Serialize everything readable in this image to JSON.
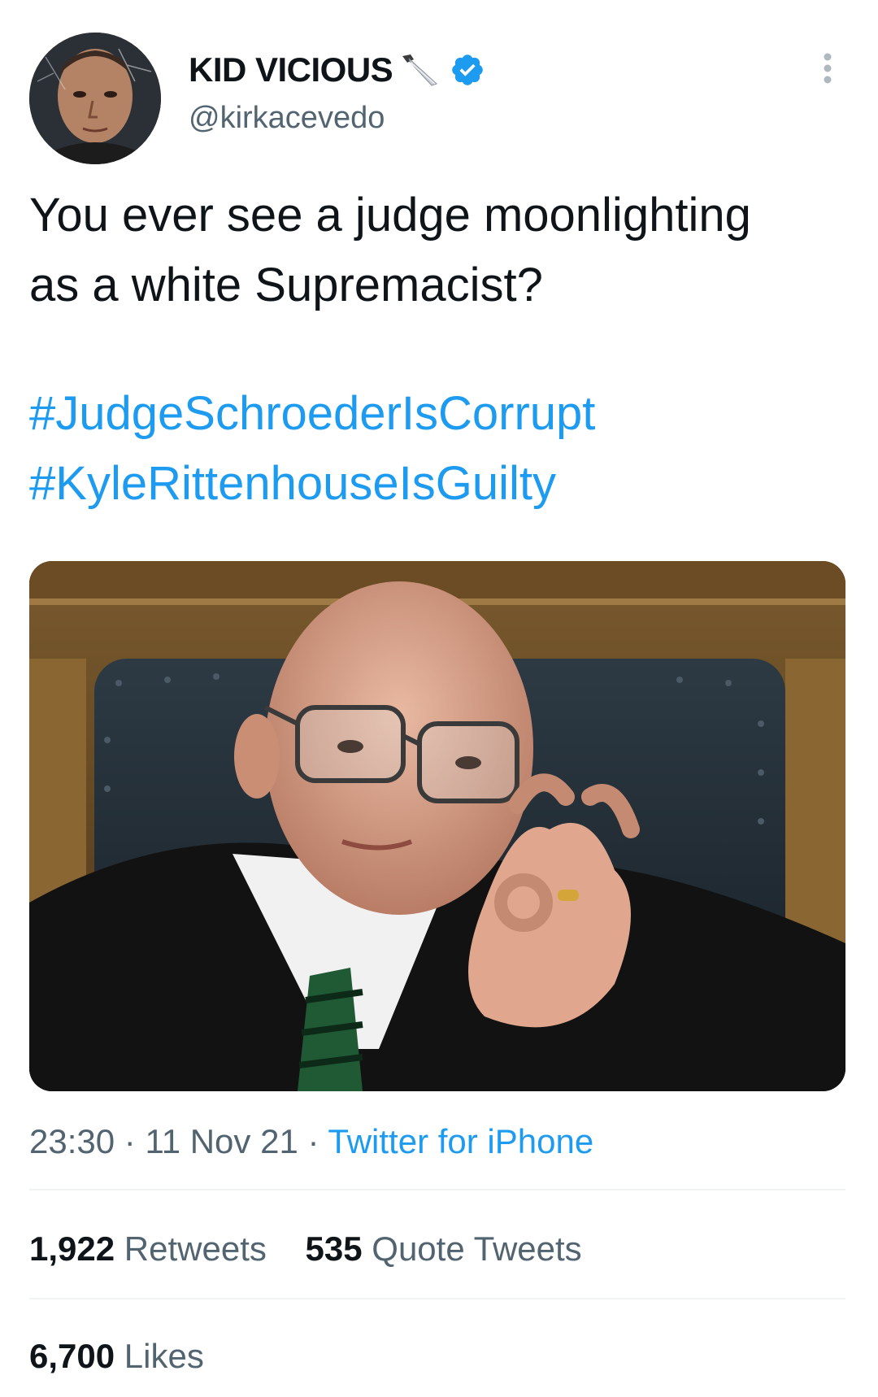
{
  "author": {
    "display_name": "KID VICIOUS",
    "name_emoji": "🔪",
    "verified_icon": "verified-badge-icon",
    "handle": "@kirkacevedo",
    "avatar_icon": "profile-avatar"
  },
  "tweet": {
    "text": "You ever see a judge moonlighting\nas a white Supremacist?",
    "hashtags": [
      "#JudgeSchroederIsCorrupt",
      "#KyleRittenhouseIsGuilty"
    ],
    "media_icon": "attached-photo"
  },
  "meta": {
    "time": "23:30",
    "separator": "·",
    "date": "11 Nov 21",
    "source": "Twitter for iPhone"
  },
  "stats": {
    "retweets_count": "1,922",
    "retweets_label": "Retweets",
    "quotes_count": "535",
    "quotes_label": "Quote Tweets",
    "likes_count": "6,700",
    "likes_label": "Likes"
  },
  "colors": {
    "link": "#1d9bf0",
    "secondary_text": "#536471",
    "primary_text": "#0f1419",
    "divider": "#eff3f4"
  }
}
